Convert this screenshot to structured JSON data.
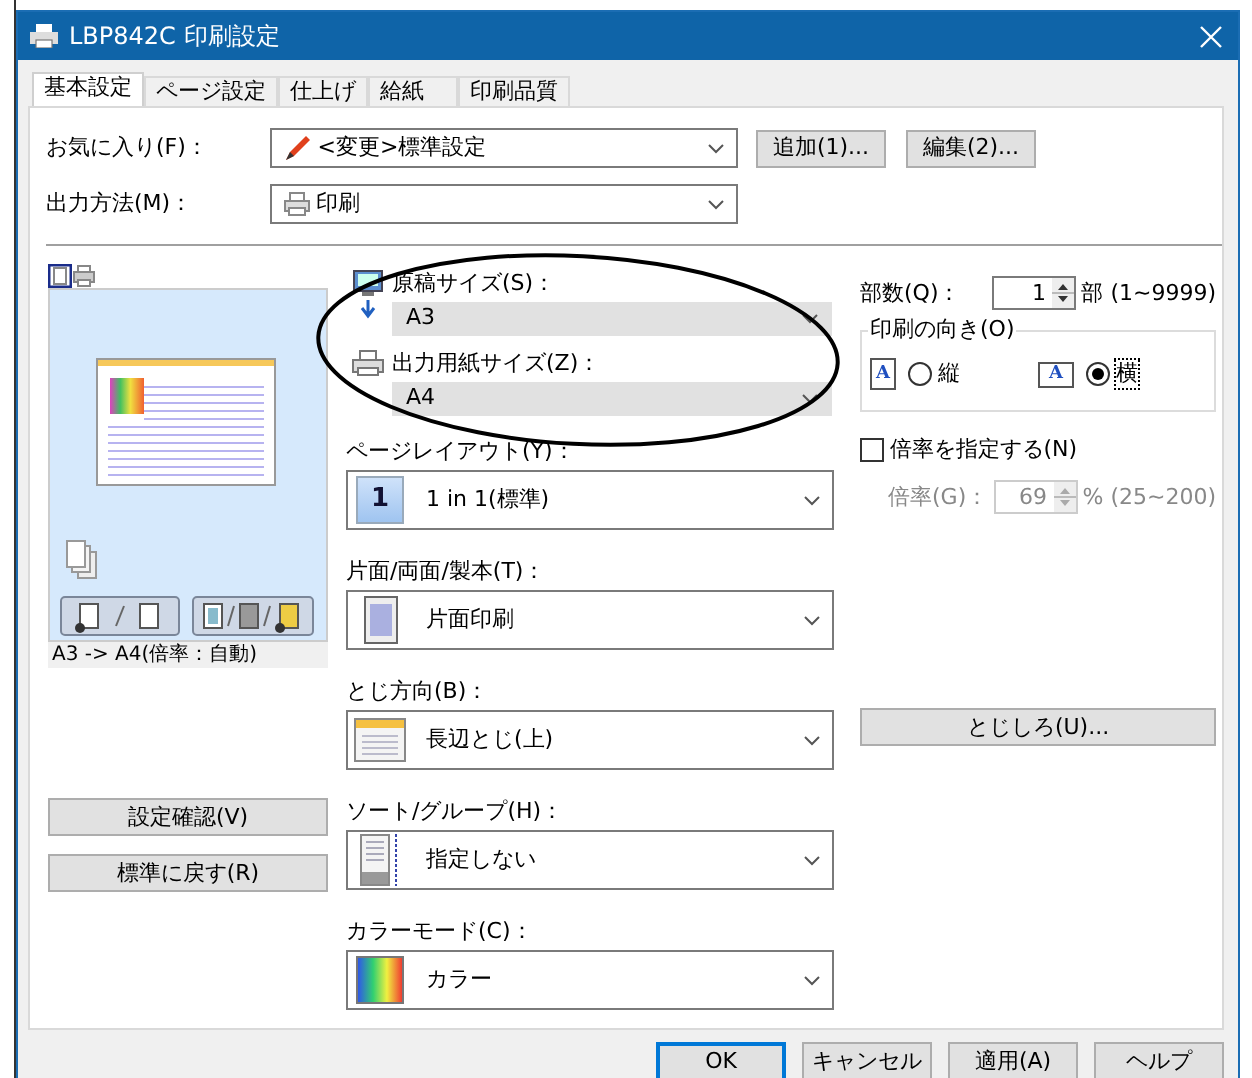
{
  "window": {
    "title": "LBP842C 印刷設定"
  },
  "tabs": [
    {
      "label": "基本設定",
      "selected": true
    },
    {
      "label": "ページ設定",
      "selected": false
    },
    {
      "label": "仕上げ",
      "selected": false
    },
    {
      "label": "給紙",
      "selected": false
    },
    {
      "label": "印刷品質",
      "selected": false
    }
  ],
  "favorites": {
    "label": "お気に入り(F)：",
    "value": "<変更>標準設定"
  },
  "favorite_buttons": [
    "追加(1)...",
    "編集(2)..."
  ],
  "output_method": {
    "label": "出力方法(M)：",
    "value": "印刷"
  },
  "preview": {
    "views": [
      {
        "kind": "page",
        "selected": true
      },
      {
        "kind": "printer",
        "selected": false
      }
    ],
    "caption": "A3 -> A4(倍率：自動)"
  },
  "left_buttons": [
    "設定確認(V)",
    "標準に戻す(R)"
  ],
  "size_fields": [
    {
      "kind": "original",
      "label": "原稿サイズ(S)：",
      "value": "A3",
      "disabled": true
    },
    {
      "kind": "output",
      "label": "出力用紙サイズ(Z)：",
      "value": "A4",
      "disabled": true
    }
  ],
  "settings": [
    {
      "kind": "layout",
      "label": "ページレイアウト(Y)：",
      "value": "1 in 1(標準)",
      "icon_text": "1"
    },
    {
      "kind": "duplex",
      "label": "片面/両面/製本(T)：",
      "value": "片面印刷"
    },
    {
      "kind": "binding",
      "label": "とじ方向(B)：",
      "value": "長辺とじ(上)"
    },
    {
      "kind": "sort",
      "label": "ソート/グループ(H)：",
      "value": "指定しない"
    },
    {
      "kind": "color",
      "label": "カラーモード(C)：",
      "value": "カラー"
    }
  ],
  "copies": {
    "label": "部数(Q)：",
    "value": "1",
    "unit": "部 (1~9999)"
  },
  "orientation": {
    "label": "印刷の向き(O)",
    "options": [
      {
        "kind": "portrait",
        "icon_text": "A",
        "label": "縦",
        "selected": false
      },
      {
        "kind": "landscape",
        "icon_text": "A",
        "label": "横",
        "selected": true
      }
    ]
  },
  "scaling": {
    "label": "倍率を指定する(N)",
    "checked": false,
    "field_label": "倍率(G)：",
    "value": "69",
    "unit": "% (25~200)",
    "disabled": true
  },
  "gutter_button": "とじしろ(U)...",
  "dialog_buttons": [
    {
      "label": "OK",
      "default": true
    },
    {
      "label": "キャンセル",
      "default": false
    },
    {
      "label": "適用(A)",
      "default": false
    },
    {
      "label": "ヘルプ",
      "default": false
    }
  ]
}
